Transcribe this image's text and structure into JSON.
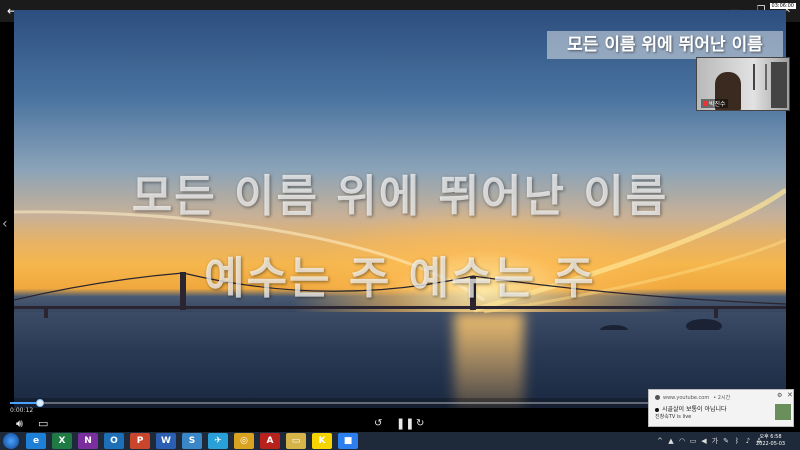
{
  "window": {
    "clock_badge": "03:06:00"
  },
  "video": {
    "lyric_line_1": "모든 이름 위에 뛰어난 이름",
    "lyric_line_2": "예수는 주 예수는 주",
    "subtitle_preview": "모든 이름 위에 뛰어난 이름",
    "webcam_name": "박진수"
  },
  "player": {
    "elapsed": "0:00:12",
    "progress_fraction": 0.038
  },
  "notification": {
    "source": "www.youtube.com",
    "age": "2시간",
    "title": "시골살이 보통이 아닙니다",
    "body": "진창속TV is live"
  },
  "taskbar": {
    "apps": [
      {
        "name": "internet-explorer-icon",
        "glyph": "e",
        "color": "#1e7fd6"
      },
      {
        "name": "excel-icon",
        "glyph": "X",
        "color": "#1f7a44"
      },
      {
        "name": "onenote-icon",
        "glyph": "N",
        "color": "#7b2f9e"
      },
      {
        "name": "outlook-icon",
        "glyph": "O",
        "color": "#1d6fb8"
      },
      {
        "name": "powerpoint-icon",
        "glyph": "P",
        "color": "#c9452b"
      },
      {
        "name": "word-icon",
        "glyph": "W",
        "color": "#2a5fb3"
      },
      {
        "name": "app-icon",
        "glyph": "S",
        "color": "#3b86c6"
      },
      {
        "name": "bird-app-icon",
        "glyph": "✈",
        "color": "#2aa0d8"
      },
      {
        "name": "chrome-icon",
        "glyph": "◎",
        "color": "#d9a321"
      },
      {
        "name": "acrobat-icon",
        "glyph": "A",
        "color": "#b8221d"
      },
      {
        "name": "file-explorer-icon",
        "glyph": "▭",
        "color": "#d6b44a"
      },
      {
        "name": "kakaotalk-icon",
        "glyph": "K",
        "color": "#f5d400"
      },
      {
        "name": "zoom-icon",
        "glyph": "■",
        "color": "#2d7ff0"
      }
    ],
    "clock_time": "오후 6:58",
    "clock_date": "2022-05-03"
  },
  "colors": {
    "accent": "#4aa3ff",
    "taskbar": "#1e2a39"
  }
}
